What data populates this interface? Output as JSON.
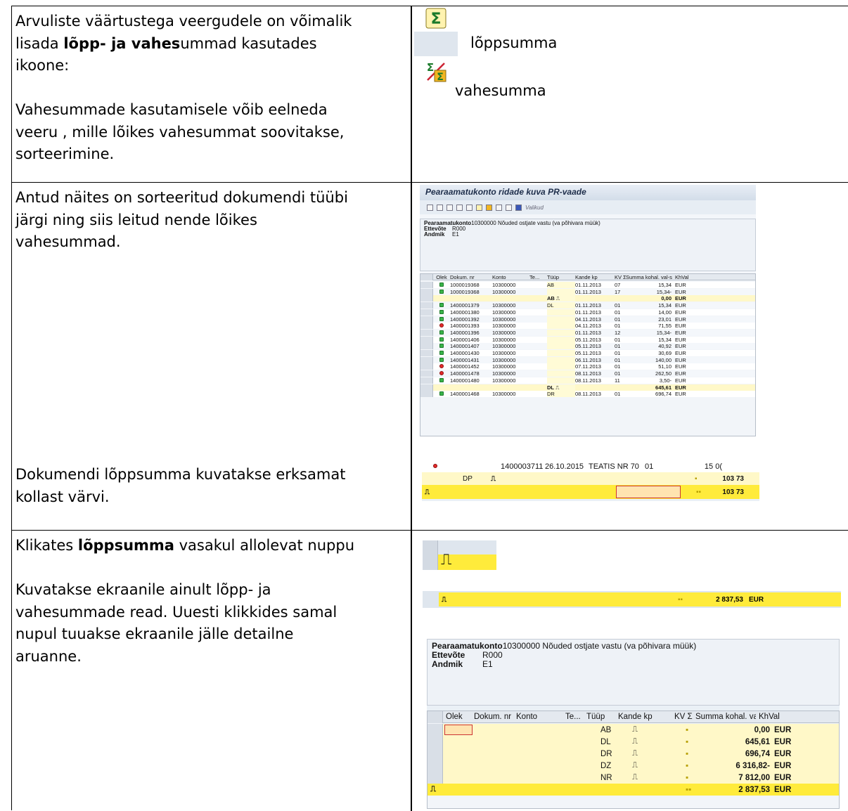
{
  "row1": {
    "left_line1": "Arvuliste väärtustega veergudele on võimalik",
    "left_line2_pre": "lisada ",
    "left_line2_bold": "lõpp- ja vahes",
    "left_line2_post": "ummad kasutades",
    "left_line3": "ikoone:",
    "left_line4": "Vahesummade kasutamisele võib eelneda",
    "left_line5": "veeru , mille lõikes vahesummat soovitakse,",
    "left_line6": "sorteerimine.",
    "total_label": "lõppsumma",
    "subtotal_label": "vahesumma",
    "total_icon": "sigma-total-icon",
    "subtotal_icon": "sigma-subtotal-icon"
  },
  "row2": {
    "left_line1": "Antud näites on sorteeritud dokumendi tüübi",
    "left_line2": "järgi ning siis leitud nende lõikes",
    "left_line3": "vahesummad.",
    "left_line4": "Dokumendi lõppsumma kuvatakse erksamat",
    "left_line5": "kollast värvi.",
    "sap": {
      "title": "Pearaamatukonto ridade kuva PR-vaade",
      "toolbar_text": "Valikud",
      "head_l1_bold": "Pearaamatukonto",
      "head_l1": "10300000 Nõuded ostjate vastu (va põhivara müük)",
      "head_l2_label": "Ettevõte",
      "head_l2_value": "R000",
      "head_l3_label": "Andmik",
      "head_l3_value": "E1",
      "columns": [
        "Olek",
        "Dokum. nr",
        "Konto",
        "Te...",
        "Tüüp",
        "Kande kp",
        "KV Σ",
        "Summa kohal. val-s",
        "KhVal"
      ],
      "rows": [
        {
          "s": "g",
          "doc": "1000019368",
          "konto": "10300000",
          "tyyp": "AB",
          "kp": "01.11.2013",
          "kv": "07",
          "summa": "15,34",
          "val": "EUR"
        },
        {
          "s": "g",
          "doc": "1000019368",
          "konto": "10300000",
          "tyyp": "",
          "kp": "01.11.2013",
          "kv": "17",
          "summa": "15,34-",
          "val": "EUR"
        },
        {
          "sum": true,
          "tyyp": "AB",
          "summa": "0,00",
          "val": "EUR"
        },
        {
          "s": "g",
          "doc": "1400001379",
          "konto": "10300000",
          "tyyp": "DL",
          "kp": "01.11.2013",
          "kv": "01",
          "summa": "15,34",
          "val": "EUR"
        },
        {
          "s": "g",
          "doc": "1400001380",
          "konto": "10300000",
          "tyyp": "",
          "kp": "01.11.2013",
          "kv": "01",
          "summa": "14,00",
          "val": "EUR"
        },
        {
          "s": "g",
          "doc": "1400001392",
          "konto": "10300000",
          "tyyp": "",
          "kp": "04.11.2013",
          "kv": "01",
          "summa": "23,01",
          "val": "EUR"
        },
        {
          "s": "r",
          "doc": "1400001393",
          "konto": "10300000",
          "tyyp": "",
          "kp": "04.11.2013",
          "kv": "01",
          "summa": "71,55",
          "val": "EUR"
        },
        {
          "s": "g",
          "doc": "1400001396",
          "konto": "10300000",
          "tyyp": "",
          "kp": "01.11.2013",
          "kv": "12",
          "summa": "15,34-",
          "val": "EUR"
        },
        {
          "s": "g",
          "doc": "1400001406",
          "konto": "10300000",
          "tyyp": "",
          "kp": "05.11.2013",
          "kv": "01",
          "summa": "15,34",
          "val": "EUR"
        },
        {
          "s": "g",
          "doc": "1400001407",
          "konto": "10300000",
          "tyyp": "",
          "kp": "05.11.2013",
          "kv": "01",
          "summa": "40,92",
          "val": "EUR"
        },
        {
          "s": "g",
          "doc": "1400001430",
          "konto": "10300000",
          "tyyp": "",
          "kp": "05.11.2013",
          "kv": "01",
          "summa": "30,69",
          "val": "EUR"
        },
        {
          "s": "g",
          "doc": "1400001431",
          "konto": "10300000",
          "tyyp": "",
          "kp": "06.11.2013",
          "kv": "01",
          "summa": "140,00",
          "val": "EUR"
        },
        {
          "s": "r",
          "doc": "1400001452",
          "konto": "10300000",
          "tyyp": "",
          "kp": "07.11.2013",
          "kv": "01",
          "summa": "51,10",
          "val": "EUR"
        },
        {
          "s": "r",
          "doc": "1400001478",
          "konto": "10300000",
          "tyyp": "",
          "kp": "08.11.2013",
          "kv": "01",
          "summa": "262,50",
          "val": "EUR"
        },
        {
          "s": "g",
          "doc": "1400001480",
          "konto": "10300000",
          "tyyp": "",
          "kp": "08.11.2013",
          "kv": "11",
          "summa": "3,50-",
          "val": "EUR"
        },
        {
          "sum": true,
          "tyyp": "DL",
          "summa": "645,61",
          "val": "EUR"
        },
        {
          "s": "g",
          "doc": "1400001468",
          "konto": "10300000",
          "tyyp": "DR",
          "kp": "08.11.2013",
          "kv": "01",
          "summa": "696,74",
          "val": "EUR"
        }
      ]
    },
    "crop": {
      "doc": "1400003711",
      "date": "26.10.2015",
      "text": "TEATIS NR 70",
      "kv": "01",
      "amount": "15 0(",
      "type": "DP",
      "sub": "103 73",
      "total": "103 73"
    }
  },
  "row3": {
    "left_line1_pre": "Klikates ",
    "left_line1_bold": "lõppsumma",
    "left_line1_post": " vasakul allolevat nuppu",
    "left_line2": "Kuvatakse ekraanile ainult lõpp- ja",
    "left_line3": "vahesummade read. Uuesti klikkides samal",
    "left_line4": "nupul tuuakse ekraanile jälle  detailne",
    "left_line5": "aruanne.",
    "strip_total": "2 837,53",
    "strip_val": "EUR",
    "sap2": {
      "head_l1_bold": "Pearaamatukonto",
      "head_l1": "10300000 Nõuded ostjate vastu (va põhivara müük)",
      "head_l2_label": "Ettevõte",
      "head_l2_value": "R000",
      "head_l3_label": "Andmik",
      "head_l3_value": "E1",
      "columns": [
        "Olek",
        "Dokum. nr",
        "Konto",
        "Te...",
        "Tüüp",
        "Kande kp",
        "KV Σ",
        "Summa kohal. val-s",
        "KhVal"
      ],
      "rows": [
        {
          "tyyp": "AB",
          "summa": "0,00",
          "val": "EUR"
        },
        {
          "tyyp": "DL",
          "summa": "645,61",
          "val": "EUR"
        },
        {
          "tyyp": "DR",
          "summa": "696,74",
          "val": "EUR"
        },
        {
          "tyyp": "DZ",
          "summa": "6 316,82-",
          "val": "EUR"
        },
        {
          "tyyp": "NR",
          "summa": "7 812,00",
          "val": "EUR"
        }
      ],
      "total": "2 837,53",
      "total_val": "EUR"
    }
  }
}
